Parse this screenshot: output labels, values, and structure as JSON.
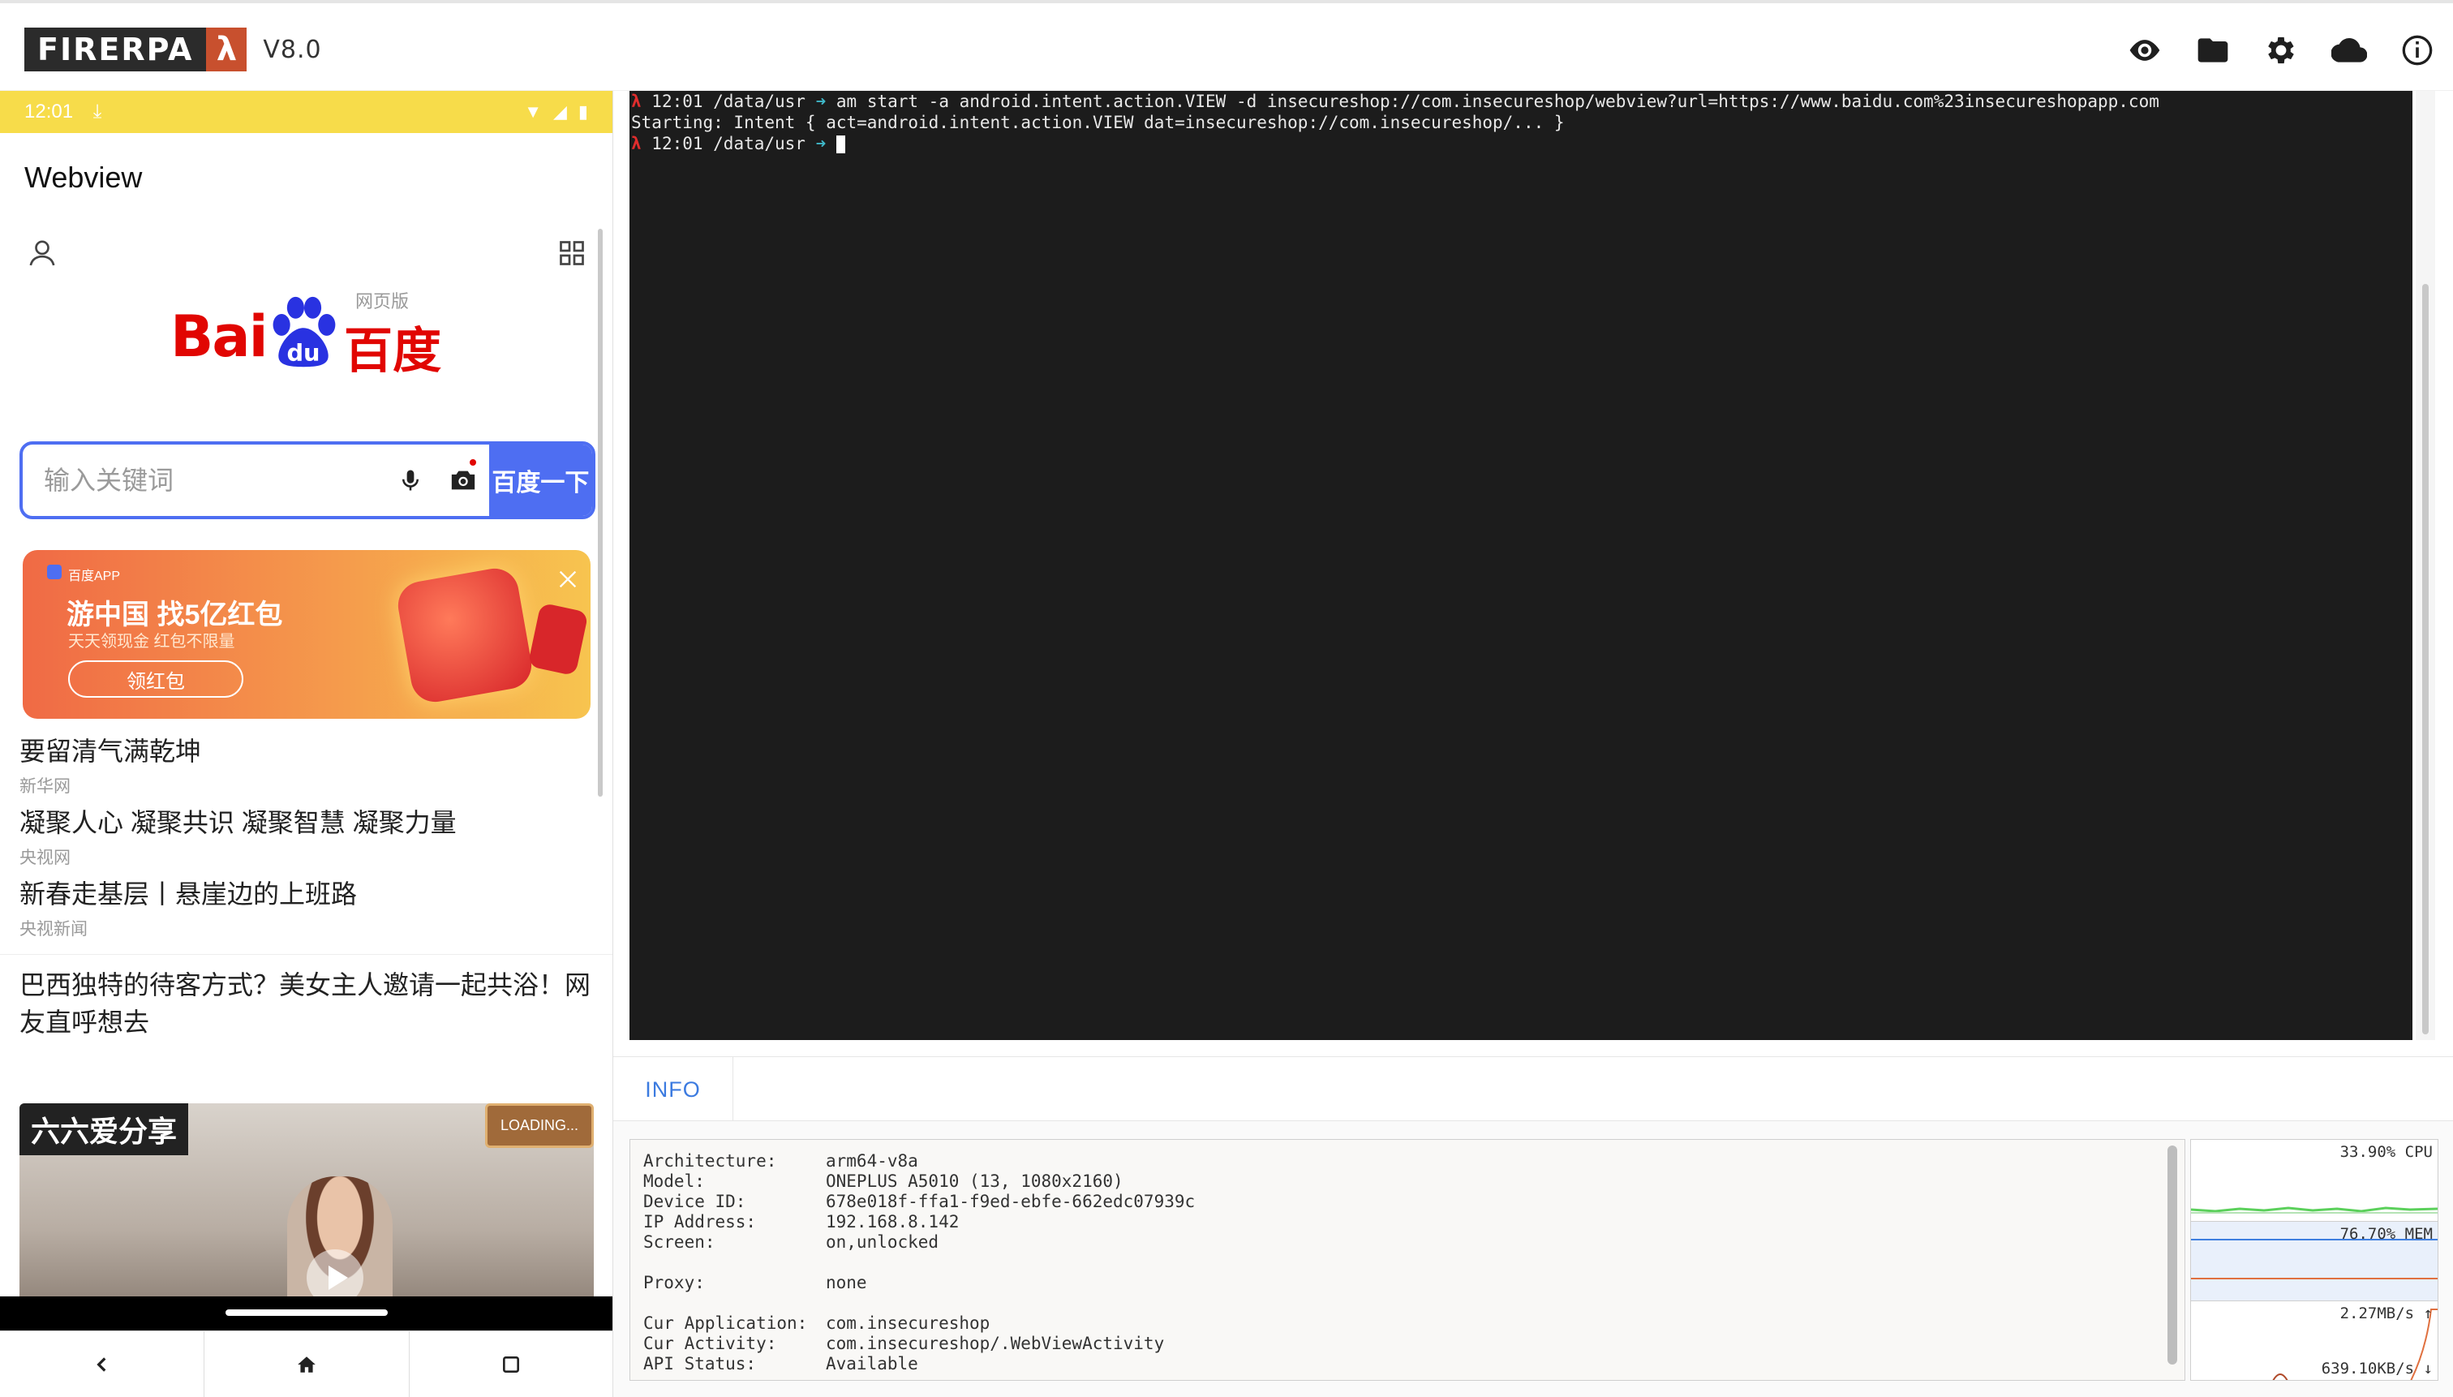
{
  "app": {
    "logo_text": "FIRERPA",
    "logo_lambda": "λ",
    "version": "V8.0",
    "top_icons": [
      "eye-icon",
      "folder-icon",
      "gear-icon",
      "cloud-icon",
      "info-icon"
    ]
  },
  "phone": {
    "status": {
      "time": "12:01",
      "download": "⤓"
    },
    "webview_title": "Webview",
    "baidu": {
      "logo_latin": "Bai",
      "logo_du": "du",
      "logo_cn": "百度",
      "logo_tag": "网页版",
      "search_placeholder": "输入关键词",
      "search_button": "百度一下"
    },
    "banner": {
      "app_label": "百度APP",
      "title": "游中国 找5亿红包",
      "subtitle": "天天领现金 红包不限量",
      "button": "领红包"
    },
    "news": [
      {
        "title": "要留清气满乾坤",
        "source": "新华网"
      },
      {
        "title": "凝聚人心 凝聚共识 凝聚智慧 凝聚力量",
        "source": "央视网"
      },
      {
        "title": "新春走基层丨悬崖边的上班路",
        "source": "央视新闻"
      }
    ],
    "feature_title": "巴西独特的待客方式？美女主人邀请一起共浴！网友直呼想去",
    "video": {
      "label": "六六爱分享",
      "badge": "LOADING..."
    }
  },
  "terminal": {
    "lines": [
      {
        "prompt": "λ",
        "path": " 12:01 /data/usr ",
        "arrow": "➜",
        "cmd": " am start -a android.intent.action.VIEW -d insecureshop://com.insecureshop/webview?url=https://www.baidu.com%23insecureshopapp.com"
      },
      {
        "output": "Starting: Intent { act=android.intent.action.VIEW dat=insecureshop://com.insecureshop/... }"
      },
      {
        "prompt": "λ",
        "path": " 12:01 /data/usr ",
        "arrow": "➜",
        "cmd": " "
      }
    ]
  },
  "info": {
    "tab_label": "INFO",
    "rows": [
      {
        "key": "Architecture:",
        "value": "arm64-v8a"
      },
      {
        "key": "Model:",
        "value": "ONEPLUS A5010 (13, 1080x2160)"
      },
      {
        "key": "Device ID:",
        "value": "678e018f-ffa1-f9ed-ebfe-662edc07939c"
      },
      {
        "key": "IP Address:",
        "value": "192.168.8.142"
      },
      {
        "key": "Screen:",
        "value": "on,unlocked"
      }
    ],
    "rows2": [
      {
        "key": "Proxy:",
        "value": "none"
      }
    ],
    "rows3": [
      {
        "key": "Cur Application:",
        "value": "com.insecureshop"
      },
      {
        "key": "Cur Activity:",
        "value": "com.insecureshop/.WebViewActivity"
      },
      {
        "key": "API Status:",
        "value": "Available"
      }
    ]
  },
  "monitor": {
    "cpu": "33.90% CPU",
    "mem": "76.70% MEM",
    "net_up": "2.27MB/s ↑",
    "net_down": "639.10KB/s ↓",
    "colors": {
      "cpu": "#5bd05b",
      "mem": "#3f7fe0",
      "net": "#e0703f"
    }
  }
}
